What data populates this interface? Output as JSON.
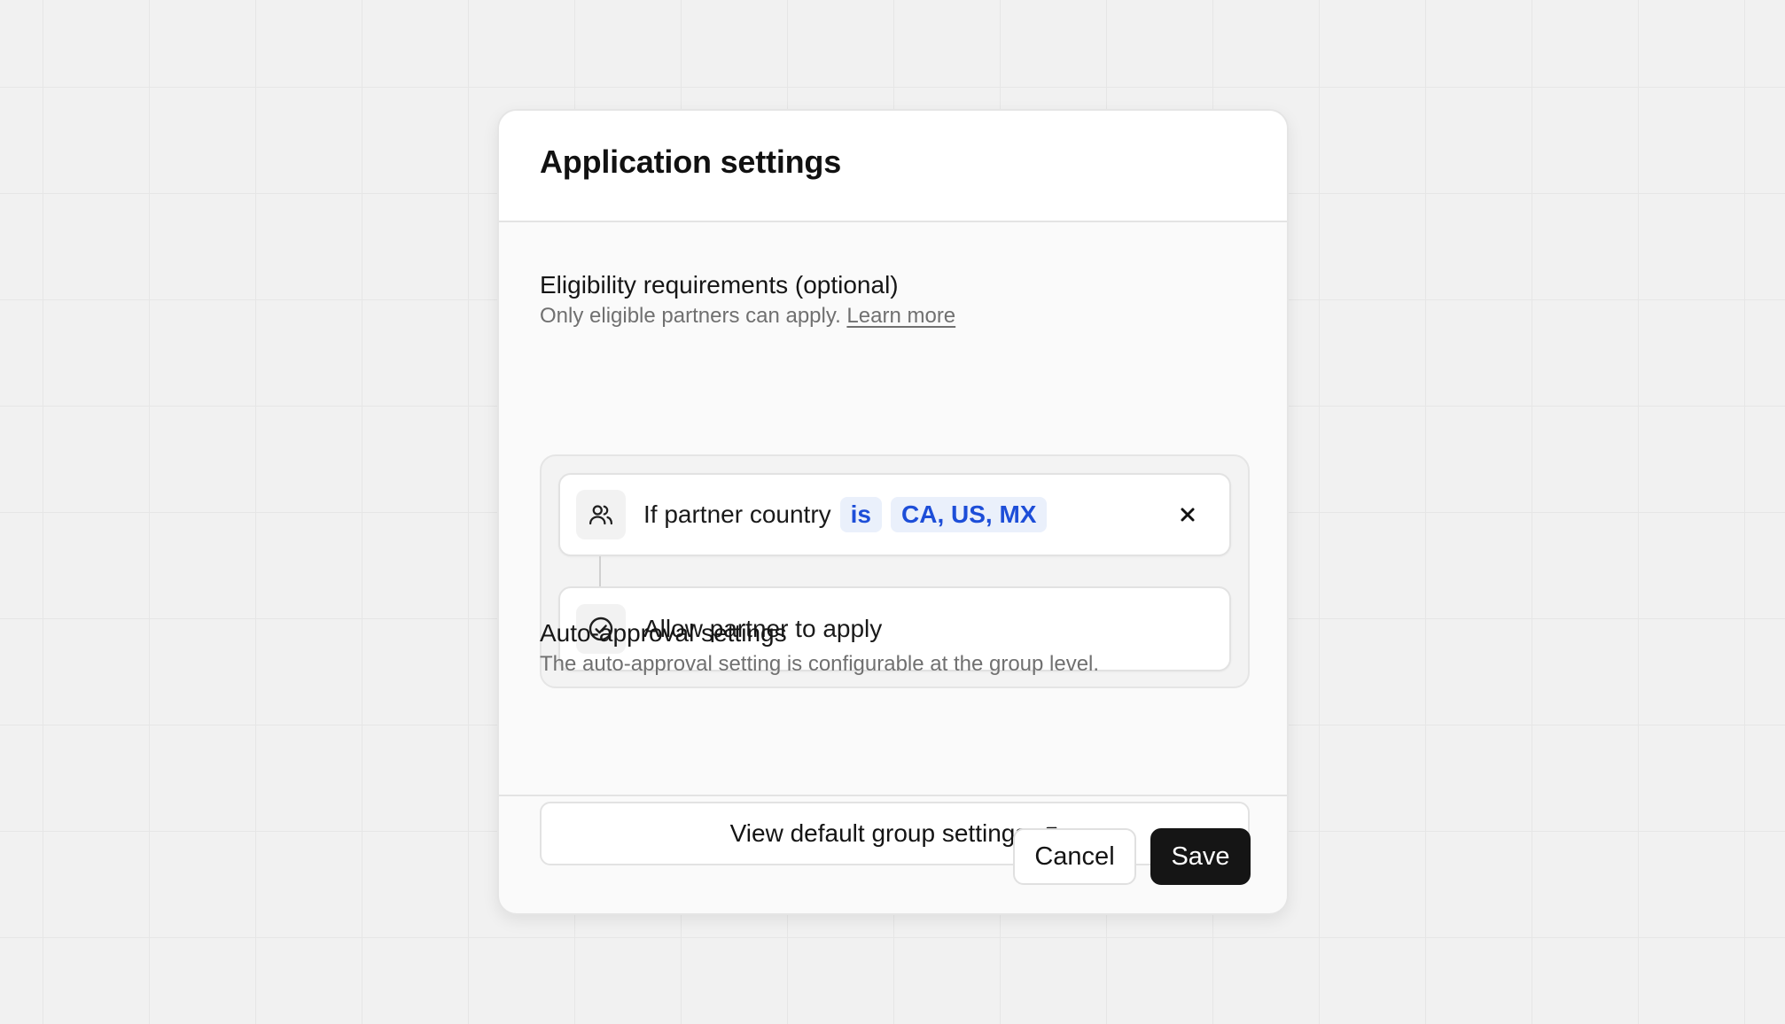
{
  "modal": {
    "title": "Application settings"
  },
  "eligibility": {
    "title": "Eligibility requirements (optional)",
    "description": "Only eligible partners can apply.",
    "learn_more": "Learn more",
    "condition": {
      "icon": "users-icon",
      "text": "If partner country",
      "operator": "is",
      "values": "CA, US, MX",
      "remove_icon": "close-icon"
    },
    "action": {
      "icon": "check-circle-icon",
      "text": "Allow partner to apply"
    }
  },
  "auto_approval": {
    "title": "Auto-approval settings",
    "description": "The auto-approval setting is configurable at the group level.",
    "button_label": "View default group settings",
    "button_icon": "arrow-up-right-icon"
  },
  "footer": {
    "cancel_label": "Cancel",
    "save_label": "Save"
  },
  "colors": {
    "accent_blue": "#1d4ed8",
    "pill_bg": "#eaf0fb",
    "primary_button": "#151515",
    "background": "#f1f1f1"
  }
}
